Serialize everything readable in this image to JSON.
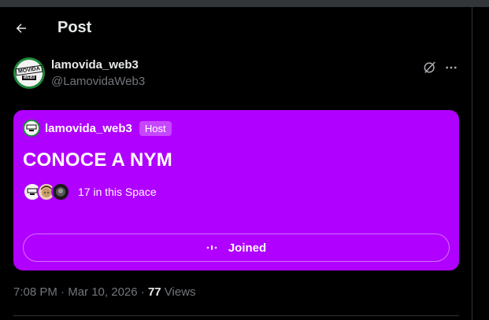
{
  "header": {
    "title": "Post",
    "back_icon": "arrow-left-icon"
  },
  "author": {
    "name": "lamovida_web3",
    "handle": "@LamovidaWeb3",
    "avatar_text": "MOVIDA",
    "avatar_sub": "WEB3"
  },
  "actions": {
    "grok_icon": "grok-icon",
    "more_icon": "more-icon"
  },
  "space": {
    "host_name": "lamovida_web3",
    "host_badge": "Host",
    "title": "CONOCE A NYM",
    "listeners_text": "17 in this Space",
    "joined_label": "Joined",
    "card_color": "#b000ff"
  },
  "meta": {
    "time": "7:08 PM",
    "separator": " · ",
    "date": "Mar 10, 2026",
    "views_count": "77",
    "views_label": " Views"
  },
  "colors": {
    "background": "#000000",
    "text_primary": "#e7e9ea",
    "text_secondary": "#71767b",
    "accent": "#b000ff"
  }
}
